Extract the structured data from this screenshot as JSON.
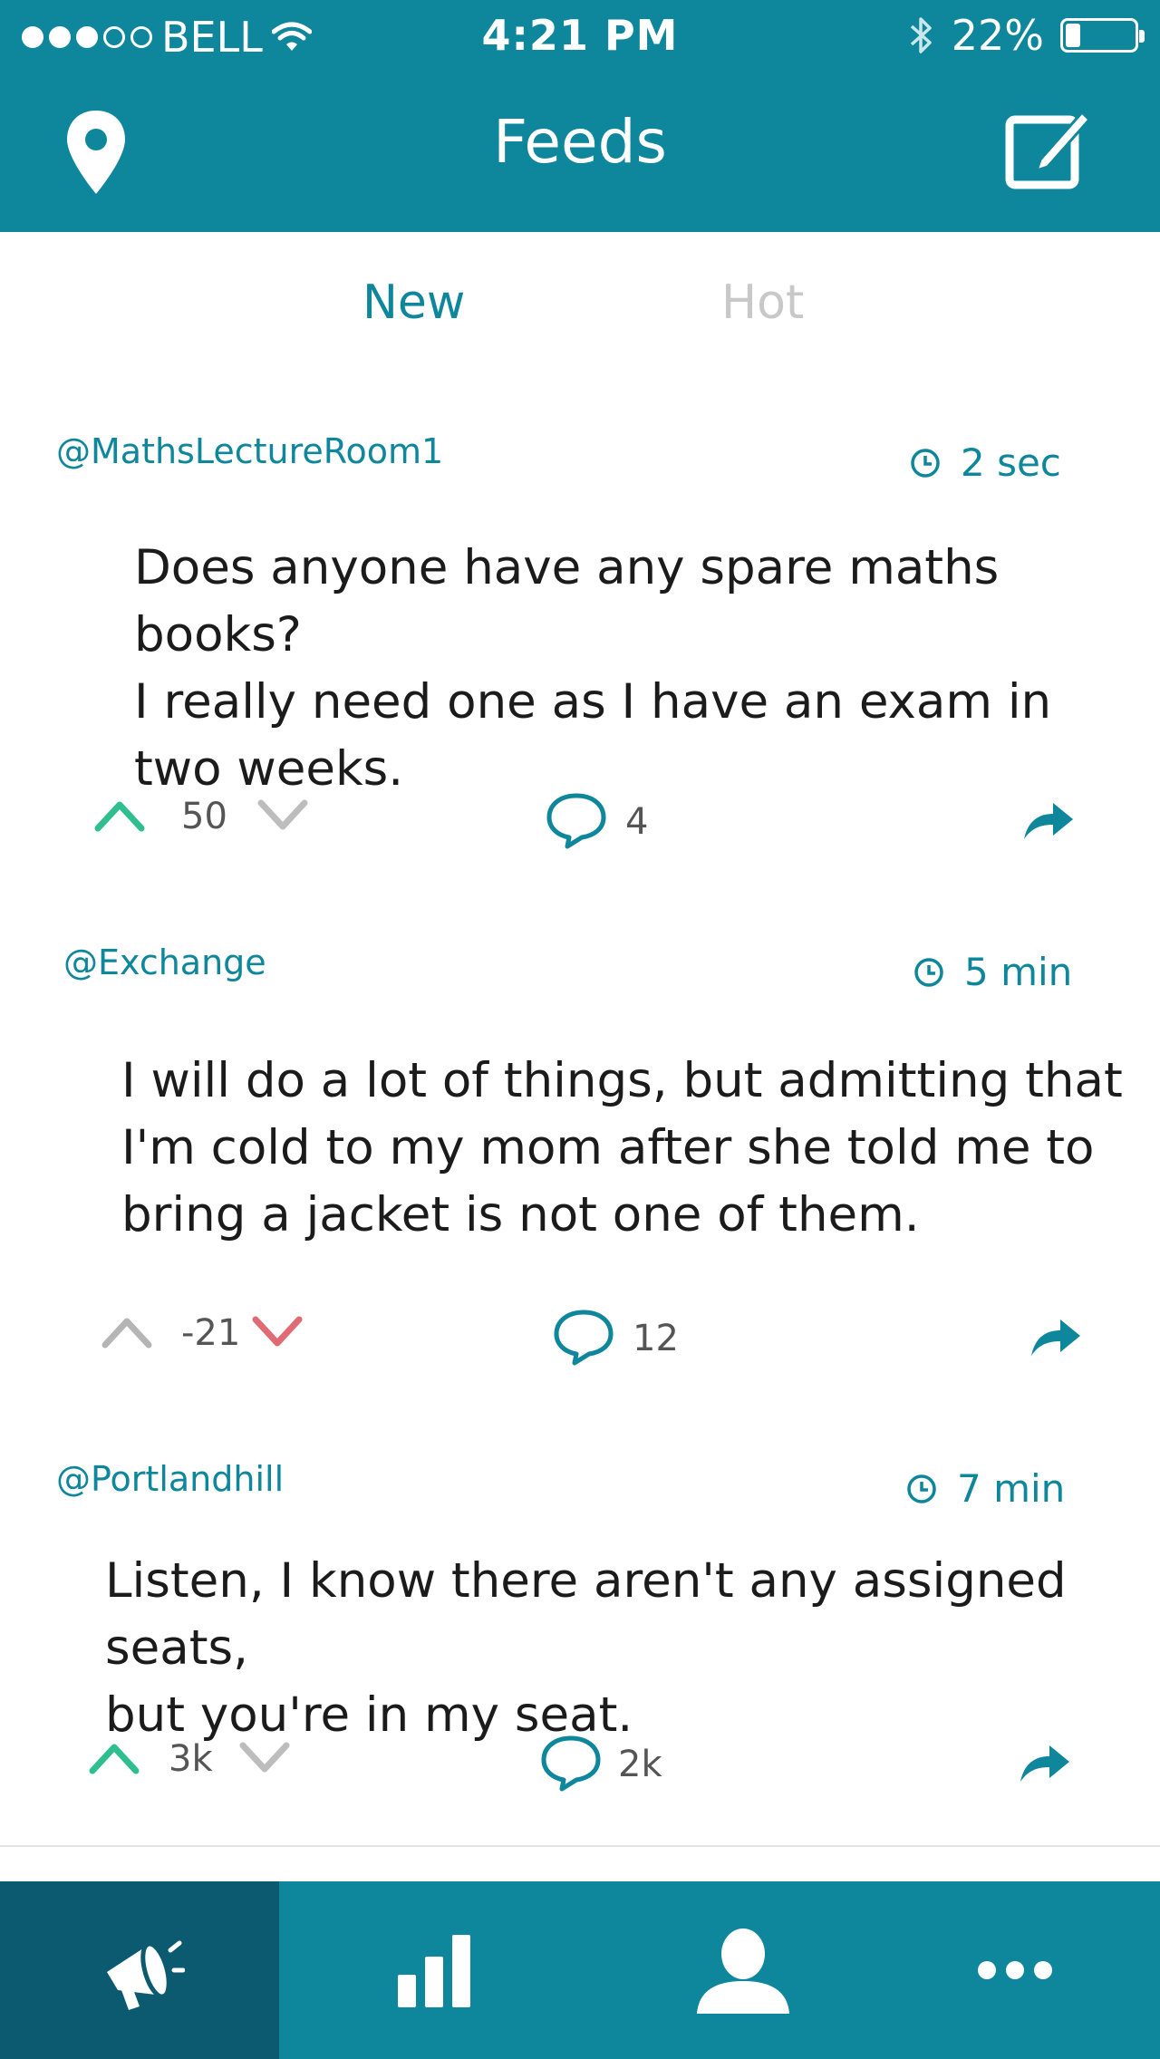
{
  "status_bar": {
    "carrier": "BELL",
    "time": "4:21 PM",
    "battery": "22%",
    "battery_level": 0.22
  },
  "header": {
    "title": "Feeds",
    "location_icon": "map-pin-icon",
    "compose_icon": "compose-edit-icon"
  },
  "tabs": [
    {
      "label": "New",
      "active": true
    },
    {
      "label": "Hot",
      "active": false
    }
  ],
  "posts": [
    {
      "handle": "@MathsLectureRoom1",
      "time": "2 sec",
      "text_lines": [
        "Does anyone have any spare maths books?",
        "I really need one as I have an exam in",
        "two weeks."
      ],
      "votes": "50",
      "vote_state": "up",
      "comments": "4"
    },
    {
      "handle": "@Exchange",
      "time": "5 min",
      "text_lines": [
        "I will do a lot of things, but admitting that",
        "I'm cold to my mom after she told me to",
        "bring a jacket is not one of them."
      ],
      "votes": "-21",
      "vote_state": "down",
      "comments": "12"
    },
    {
      "handle": "@Portlandhill",
      "time": "7 min",
      "text_lines": [
        "Listen, I know there aren't any assigned seats,",
        "but you're in my seat."
      ],
      "votes": "3k",
      "vote_state": "up",
      "comments": "2k"
    }
  ],
  "tab_bar": [
    {
      "icon": "megaphone-icon",
      "active": true
    },
    {
      "icon": "bar-chart-icon",
      "active": false
    },
    {
      "icon": "user-profile-icon",
      "active": false
    },
    {
      "icon": "more-dots-icon",
      "active": false
    }
  ],
  "colors": {
    "brand": "#0e869b",
    "brand_dark": "#0b5a6f",
    "upvote": "#2fbf8f",
    "downvote": "#e06b74",
    "inactive": "#b5b5b5"
  }
}
